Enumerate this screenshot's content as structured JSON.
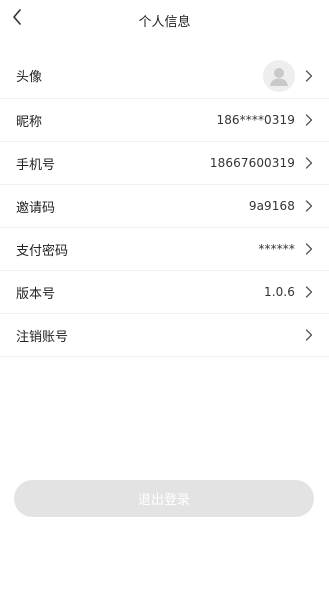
{
  "header": {
    "title": "个人信息",
    "back_icon": "chevron-left-icon"
  },
  "profile": {
    "avatar": {
      "label": "头像",
      "icon": "user-avatar-placeholder-icon"
    },
    "rows": [
      {
        "label": "昵称",
        "value": "186****0319"
      },
      {
        "label": "手机号",
        "value": "18667600319"
      },
      {
        "label": "邀请码",
        "value": "9a9168"
      },
      {
        "label": "支付密码",
        "value": "******"
      },
      {
        "label": "版本号",
        "value": "1.0.6"
      },
      {
        "label": "注销账号",
        "value": ""
      }
    ]
  },
  "logout": {
    "label": "退出登录"
  },
  "colors": {
    "divider": "#f1f1f1",
    "button_bg": "#e3e3e3",
    "button_text": "#ffffff",
    "chevron": "#555555"
  }
}
